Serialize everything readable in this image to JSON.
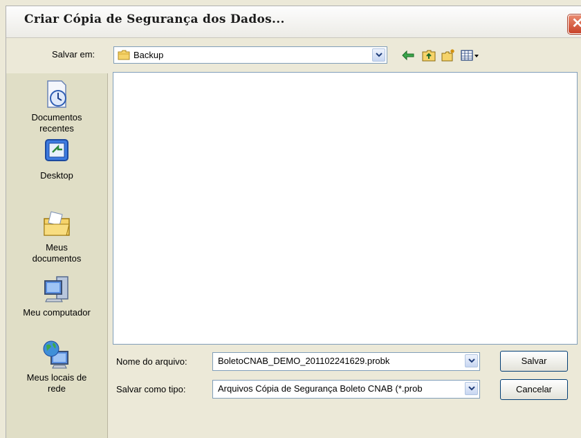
{
  "window": {
    "title": "Criar Cópia de Segurança dos Dados...",
    "close_glyph": "✕"
  },
  "toolbar": {
    "save_in_label": "Salvar em:",
    "save_in_value": "Backup",
    "icons": [
      "back-arrow-icon",
      "up-folder-icon",
      "new-folder-icon",
      "view-menu-icon"
    ]
  },
  "places": [
    {
      "label": "Documentos recentes",
      "icon": "recent-documents-icon"
    },
    {
      "label": "Desktop",
      "icon": "desktop-icon"
    },
    {
      "label": "Meus documentos",
      "icon": "my-documents-icon"
    },
    {
      "label": "Meu computador",
      "icon": "my-computer-icon"
    },
    {
      "label": "Meus locais de rede",
      "icon": "network-places-icon"
    }
  ],
  "form": {
    "filename_label": "Nome do arquivo:",
    "filename_value": "BoletoCNAB_DEMO_201102241629.probk",
    "filetype_label": "Salvar como tipo:",
    "filetype_value": "Arquivos Cópia de Segurança Boleto CNAB (*.prob"
  },
  "buttons": {
    "save": "Salvar",
    "cancel": "Cancelar"
  },
  "colors": {
    "accent": "#316ac5",
    "close": "#c8432a",
    "places_bg": "#e0dec6"
  }
}
